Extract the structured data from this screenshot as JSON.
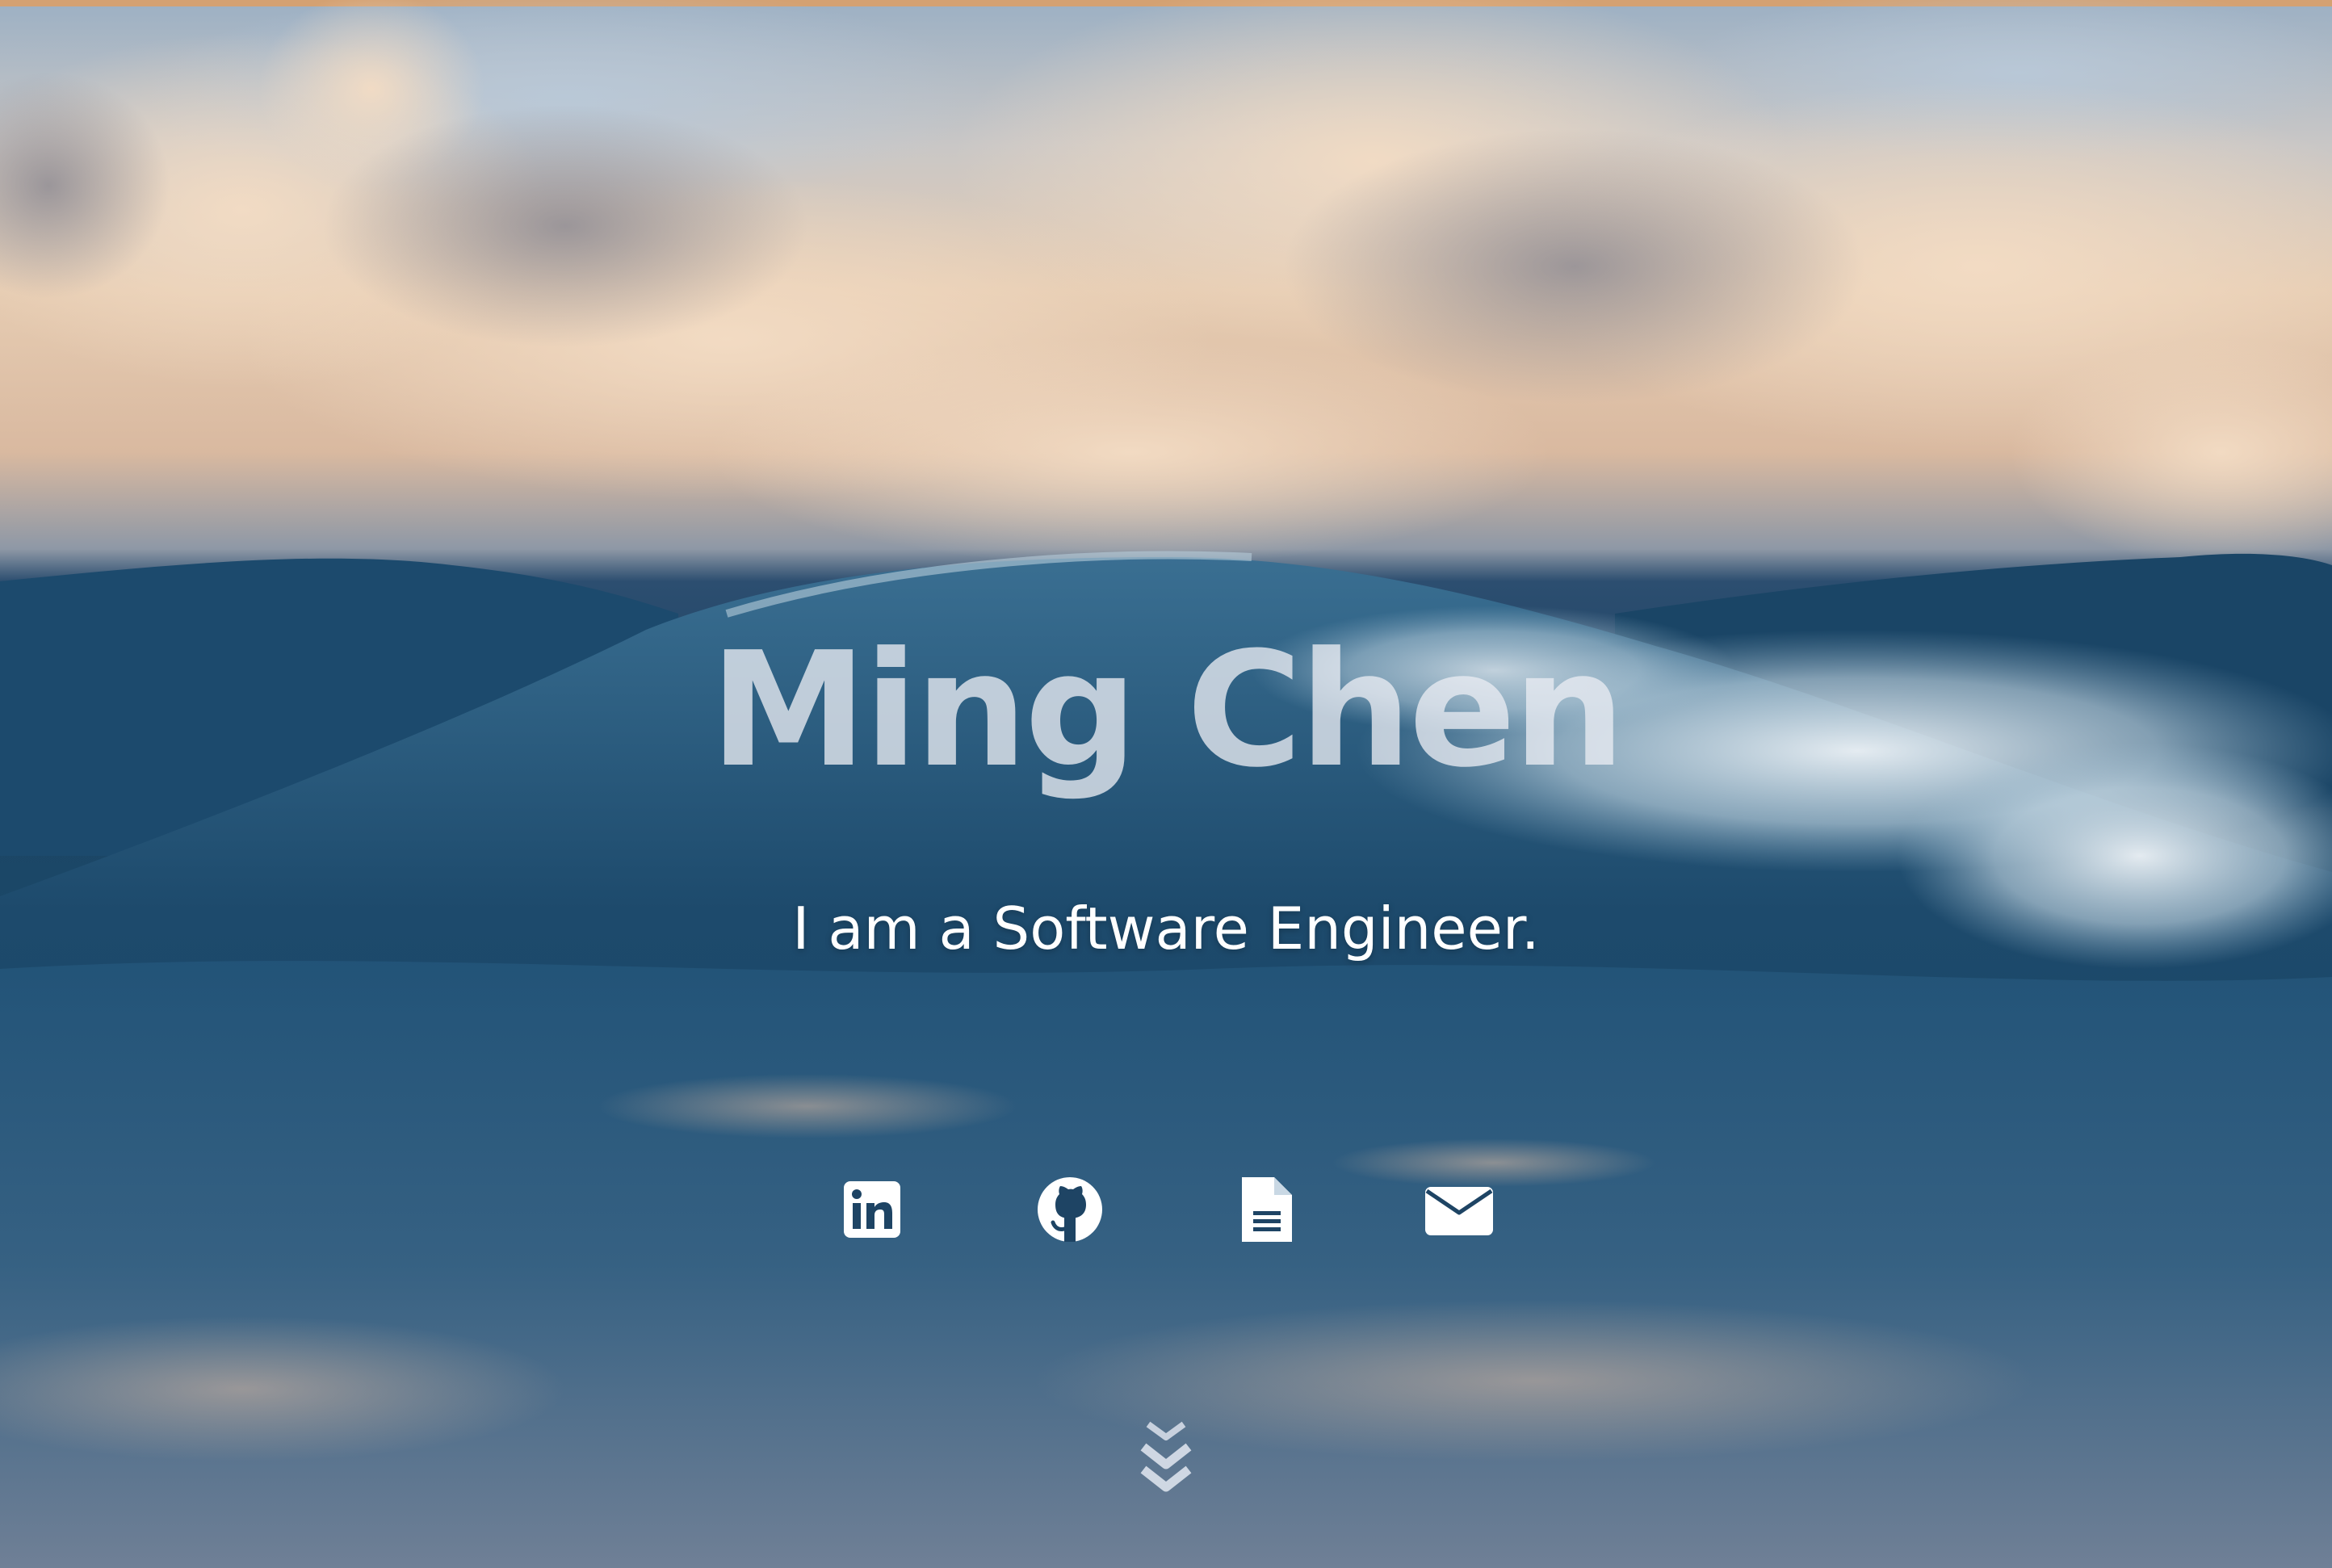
{
  "hero": {
    "name": "Ming Chen",
    "tagline": "I am a Software Engineer."
  },
  "social": [
    {
      "icon": "linkedin-icon"
    },
    {
      "icon": "github-icon"
    },
    {
      "icon": "resume-document-icon"
    },
    {
      "icon": "envelope-icon"
    }
  ],
  "scroll": {
    "icon": "double-chevron-down-icon"
  },
  "colors": {
    "accent_strip": "#d4a172",
    "title": "#e9ecf2",
    "icons": "#ffffff"
  }
}
